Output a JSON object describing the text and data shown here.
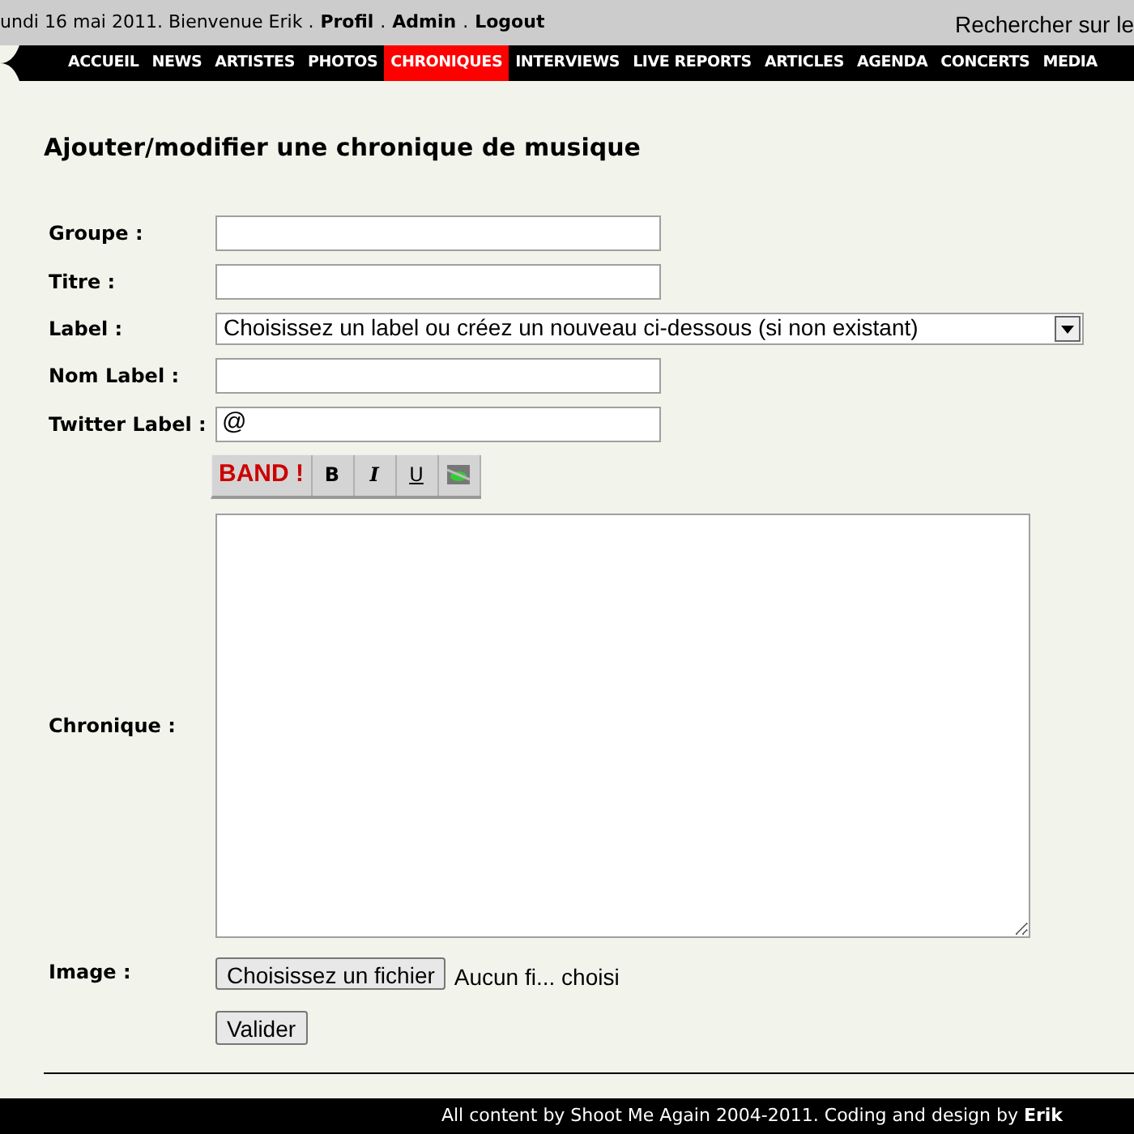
{
  "top_bar": {
    "greeting": "undi 16 mai 2011. Bienvenue Erik .",
    "links": [
      "Profil",
      "Admin",
      "Logout"
    ],
    "separator": ".",
    "search_text": "Rechercher sur le"
  },
  "nav": [
    {
      "label": "ACCUEIL",
      "selected": false
    },
    {
      "label": "NEWS",
      "selected": false
    },
    {
      "label": "ARTISTES",
      "selected": false
    },
    {
      "label": "PHOTOS",
      "selected": false
    },
    {
      "label": "CHRONIQUES",
      "selected": true
    },
    {
      "label": "INTERVIEWS",
      "selected": false
    },
    {
      "label": "LIVE REPORTS",
      "selected": false
    },
    {
      "label": "ARTICLES",
      "selected": false
    },
    {
      "label": "AGENDA",
      "selected": false
    },
    {
      "label": "CONCERTS",
      "selected": false
    },
    {
      "label": "MEDIA",
      "selected": false
    }
  ],
  "heading": "Ajouter/modifier une chronique de musique",
  "fields": [
    {
      "kind": "text",
      "label": "Groupe :"
    },
    {
      "kind": "text",
      "label": "Titre :"
    },
    {
      "kind": "select",
      "label": "Label :",
      "value": "Choisissez un label ou créez un nouveau ci-dessous (si non existant)"
    },
    {
      "kind": "text",
      "label": "Nom Label :"
    },
    {
      "kind": "text",
      "label": "Twitter Label :",
      "value": "@"
    }
  ],
  "toolbar": [
    {
      "kind": "brand",
      "text": "BAND !"
    },
    {
      "kind": "bold",
      "text": "B"
    },
    {
      "kind": "italic",
      "text": "I"
    },
    {
      "kind": "underline",
      "text": "U"
    },
    {
      "kind": "image"
    }
  ],
  "chronique_label": "Chronique :",
  "image": {
    "label": "Image :",
    "button": "Choisissez un fichier",
    "status": "Aucun fi... choisi"
  },
  "submit": "Valider",
  "footer": "All content by Shoot Me Again 2004-2011. Coding and design by **Erik**"
}
